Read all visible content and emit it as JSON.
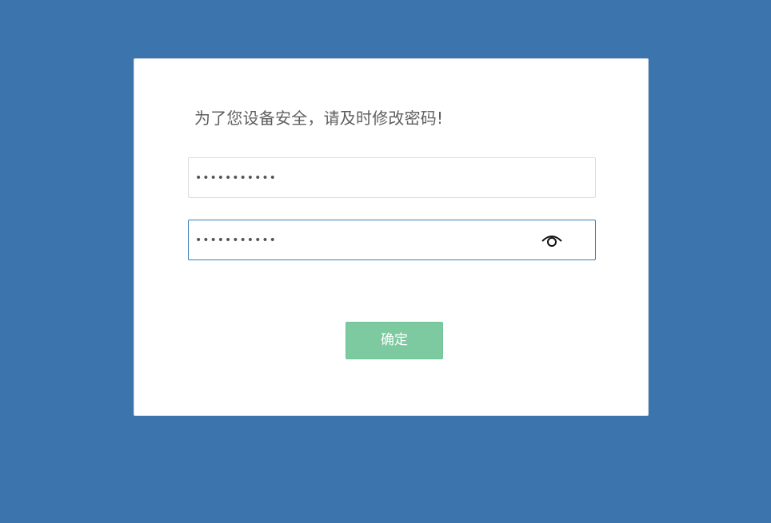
{
  "dialog": {
    "notice": "为了您设备安全，请及时修改密码!",
    "new_password": {
      "value": "12345678901",
      "type": "password",
      "state": "default"
    },
    "confirm_password": {
      "value": "12345678901",
      "type": "password",
      "state": "focused",
      "toggle_icon": "eye-icon"
    },
    "confirm_button": {
      "label": "确定",
      "color": "#7dc9a0"
    }
  },
  "colors": {
    "background": "#3c74ae",
    "dialog_background": "#ffffff",
    "focused_border": "#3a7db6"
  }
}
